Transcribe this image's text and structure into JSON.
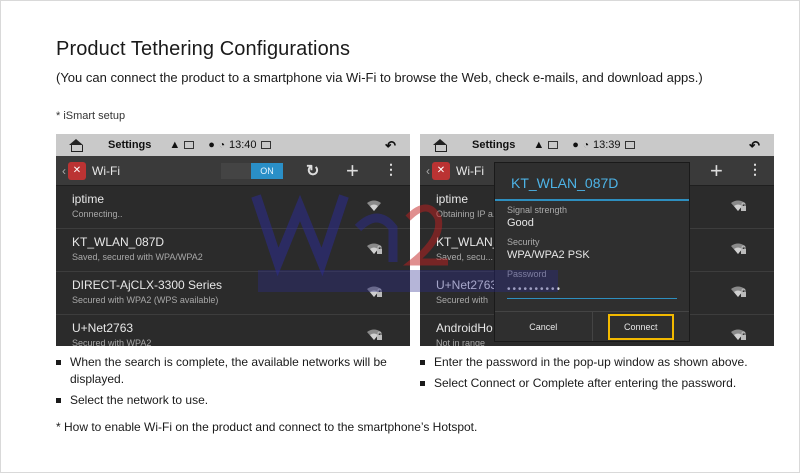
{
  "page": {
    "title": "Product Tethering Configurations",
    "subtitle": "(You can connect the product to a smartphone via Wi-Fi to browse the Web, check e-mails, and download apps.)",
    "setup_label": "* iSmart setup",
    "footnote": "* How to enable Wi-Fi on the product and connect to the smartphone’s Hotspot."
  },
  "left_screen": {
    "statusbar": {
      "title": "Settings",
      "time": "13:40"
    },
    "actionbar": {
      "title": "Wi-Fi",
      "toggle": "ON"
    },
    "networks": [
      {
        "name": "iptime",
        "status": "Connecting..",
        "secured": false
      },
      {
        "name": "KT_WLAN_087D",
        "status": "Saved, secured with WPA/WPA2",
        "secured": true
      },
      {
        "name": "DIRECT-AjCLX-3300 Series",
        "status": "Secured with WPA2 (WPS available)",
        "secured": true
      },
      {
        "name": "U+Net2763",
        "status": "Secured with WPA2",
        "secured": true
      }
    ]
  },
  "right_screen": {
    "statusbar": {
      "title": "Settings",
      "time": "13:39"
    },
    "actionbar": {
      "title": "Wi-Fi"
    },
    "background_rows": [
      {
        "name": "iptime",
        "status": "Obtaining IP a..."
      },
      {
        "name": "KT_WLAN_...",
        "status": "Saved, secu..."
      },
      {
        "name": "U+Net2763",
        "status": "Secured with"
      },
      {
        "name": "AndroidHo",
        "status": "Not in range"
      }
    ],
    "dialog": {
      "title": "KT_WLAN_087D",
      "signal_label": "Signal strength",
      "signal_value": "Good",
      "security_label": "Security",
      "security_value": "WPA/WPA2 PSK",
      "password_label": "Password",
      "password_mask": "••••••••••",
      "cancel_label": "Cancel",
      "connect_label": "Connect"
    }
  },
  "instructions": {
    "left": [
      "When the search is complete, the available networks will be displayed.",
      "Select the network to use."
    ],
    "right": [
      "Enter the password in the pop-up window as shown above.",
      "Select Connect or Complete after entering the password."
    ]
  },
  "colors": {
    "accent": "#2a8fc7",
    "highlight": "#f2b900",
    "screen_bg": "#2b2b2b"
  }
}
